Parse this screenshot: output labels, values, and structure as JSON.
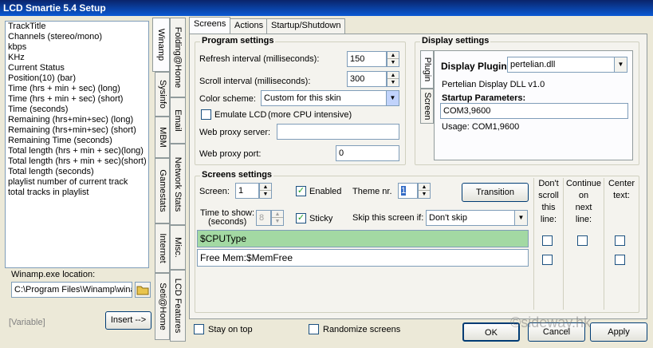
{
  "window": {
    "title": "LCD Smartie 5.4 Setup"
  },
  "variables": {
    "items": [
      "TrackTitle",
      "Channels (stereo/mono)",
      "kbps",
      "KHz",
      "Current Status",
      "Position(10) (bar)",
      "Time (hrs + min + sec) (long)",
      "Time (hrs + min + sec) (short)",
      "Time (seconds)",
      "Remaining (hrs+min+sec) (long)",
      "Remaining (hrs+min+sec) (short)",
      "Remaining Time (seconds)",
      "Total length (hrs + min + sec)(long)",
      "Total length (hrs + min + sec)(short)",
      "Total length (seconds)",
      "playlist number of current track",
      "total tracks in playlist"
    ],
    "location_label": "Winamp.exe location:",
    "location_value": "C:\\Program Files\\Winamp\\wina",
    "variable_placeholder": "[Variable]",
    "insert_button": "Insert -->"
  },
  "plugin_tabs": {
    "col1": [
      "Winamp",
      "Sysinfo",
      "MBM",
      "Gamestats",
      "Internet",
      "Seti@Home"
    ],
    "col2": [
      "Folding@Home",
      "Email",
      "Network Stats",
      "Misc.",
      "LCD Features"
    ]
  },
  "main_tabs": [
    "Screens",
    "Actions",
    "Startup/Shutdown"
  ],
  "program_settings": {
    "title": "Program settings",
    "refresh_label": "Refresh interval (milliseconds):",
    "refresh_value": "150",
    "scroll_label": "Scroll interval (milliseconds):",
    "scroll_value": "300",
    "color_label": "Color scheme:",
    "color_value": "Custom for this skin",
    "emulate_label": "Emulate LCD",
    "emulate_hint": "(more CPU intensive)",
    "proxy_server_label": "Web proxy server:",
    "proxy_server_value": "",
    "proxy_port_label": "Web proxy port:",
    "proxy_port_value": "0"
  },
  "display_settings": {
    "title": "Display settings",
    "tab_plugin": "Plugin",
    "tab_screen": "Screen",
    "plugin_label": "Display Plugin:",
    "plugin_value": "pertelian.dll",
    "plugin_desc": "Pertelian Display DLL v1.0",
    "startup_label": "Startup Parameters:",
    "startup_value": "COM3,9600",
    "usage_text": "Usage: COM1,9600"
  },
  "screens_settings": {
    "title": "Screens settings",
    "screen_label": "Screen:",
    "screen_value": "1",
    "enabled_label": "Enabled",
    "theme_label": "Theme nr.",
    "theme_value": "1",
    "transition_button": "Transition",
    "time_label_1": "Time to show:",
    "time_label_2": "(seconds)",
    "time_value": "8",
    "sticky_label": "Sticky",
    "skip_label": "Skip this screen if:",
    "skip_value": "Don't skip",
    "col_dont_scroll": [
      "Don't",
      "scroll",
      "this",
      "line:"
    ],
    "col_continue": [
      "Continue",
      "on",
      "next",
      "line:"
    ],
    "col_center": [
      "Center",
      "text:"
    ],
    "lines": [
      "$CPUType",
      "Free Mem:$MemFree"
    ]
  },
  "footer": {
    "stay_on_top": "Stay on top",
    "randomize": "Randomize screens",
    "ok": "OK",
    "cancel": "Cancel",
    "apply": "Apply",
    "watermark": "©sideway.hk"
  }
}
